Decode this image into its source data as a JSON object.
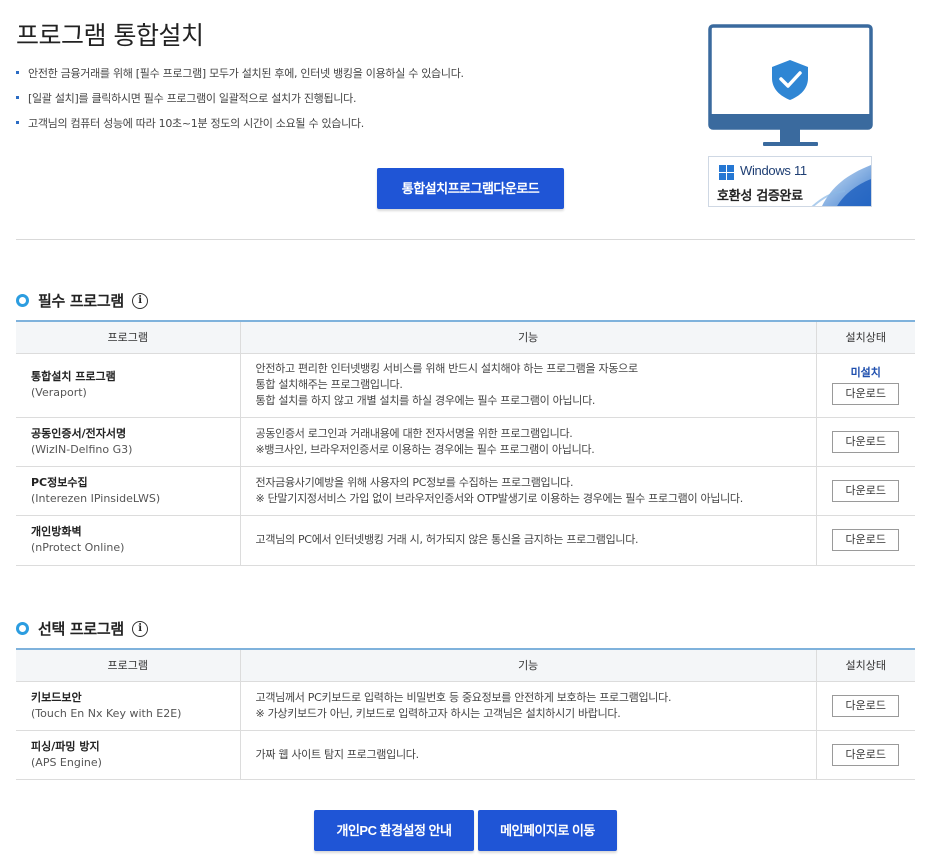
{
  "page": {
    "title": "프로그램 통합설치",
    "notes": [
      "안전한 금융거래를 위해 [필수 프로그램] 모두가 설치된 후에, 인터넷 뱅킹을 이용하실 수 있습니다.",
      "[일괄 설치]를 클릭하시면 필수 프로그램이 일괄적으로 설치가 진행됩니다.",
      "고객님의 컴퓨터 성능에 따라 10초~1분 정도의 시간이 소요될 수 있습니다."
    ],
    "install_button": "통합설치프로그램다운로드"
  },
  "badge": {
    "windows": "Windows 11",
    "verified": "호환성 검증완료",
    "monitor_icon": "shield-check-icon"
  },
  "required": {
    "title": "필수 프로그램",
    "info_icon": "i",
    "headers": {
      "program": "프로그램",
      "function": "기능",
      "status": "설치상태"
    },
    "rows": [
      {
        "name": "통합설치 프로그램",
        "en": "(Veraport)",
        "desc": [
          "안전하고 편리한 인터넷뱅킹 서비스를 위해 반드시 설치해야 하는 프로그램을 자동으로",
          "통합 설치해주는 프로그램입니다.",
          "통합 설치를 하지 않고 개별 설치를 하실 경우에는 필수 프로그램이 아닙니다."
        ],
        "status": "미설치",
        "button": "다운로드"
      },
      {
        "name": "공동인증서/전자서명",
        "en": "(WizIN-Delfino G3)",
        "desc": [
          "공동인증서 로그인과 거래내용에 대한 전자서명을 위한 프로그램입니다.",
          "※뱅크사인, 브라우저인증서로 이용하는 경우에는 필수 프로그램이 아닙니다."
        ],
        "status": "",
        "button": "다운로드"
      },
      {
        "name": "PC정보수집",
        "en": "(Interezen IPinsideLWS)",
        "desc": [
          "전자금융사기예방을 위해 사용자의 PC정보를 수집하는 프로그램입니다.",
          "※ 단말기지정서비스 가입 없이 브라우저인증서와 OTP발생기로 이용하는 경우에는 필수 프로그램이 아닙니다."
        ],
        "status": "",
        "button": "다운로드"
      },
      {
        "name": "개인방화벽",
        "en": "(nProtect Online)",
        "desc": [
          "고객님의 PC에서 인터넷뱅킹 거래 시, 허가되지 않은 통신을 금지하는 프로그램입니다."
        ],
        "status": "",
        "button": "다운로드"
      }
    ]
  },
  "optional": {
    "title": "선택 프로그램",
    "info_icon": "i",
    "headers": {
      "program": "프로그램",
      "function": "기능",
      "status": "설치상태"
    },
    "rows": [
      {
        "name": "키보드보안",
        "en": "(Touch En Nx Key with E2E)",
        "desc": [
          "고객님께서 PC키보드로 입력하는 비밀번호 등 중요정보를 안전하게 보호하는 프로그램입니다.",
          "※ 가상키보드가 아닌, 키보드로 입력하고자 하시는 고객님은 설치하시기 바랍니다."
        ],
        "button": "다운로드"
      },
      {
        "name": "피싱/파밍 방지",
        "en": "(APS Engine)",
        "desc": [
          "가짜 웹 사이트 탐지 프로그램입니다."
        ],
        "button": "다운로드"
      }
    ]
  },
  "footer": {
    "pc_guide": "개인PC 환경설정 안내",
    "main_page": "메인페이지로 이동"
  },
  "colors": {
    "primary_button": "#1f55d6",
    "table_top_border": "#7fb2dc",
    "status": "#1f4fae",
    "monitor": "#3a6a9e"
  }
}
